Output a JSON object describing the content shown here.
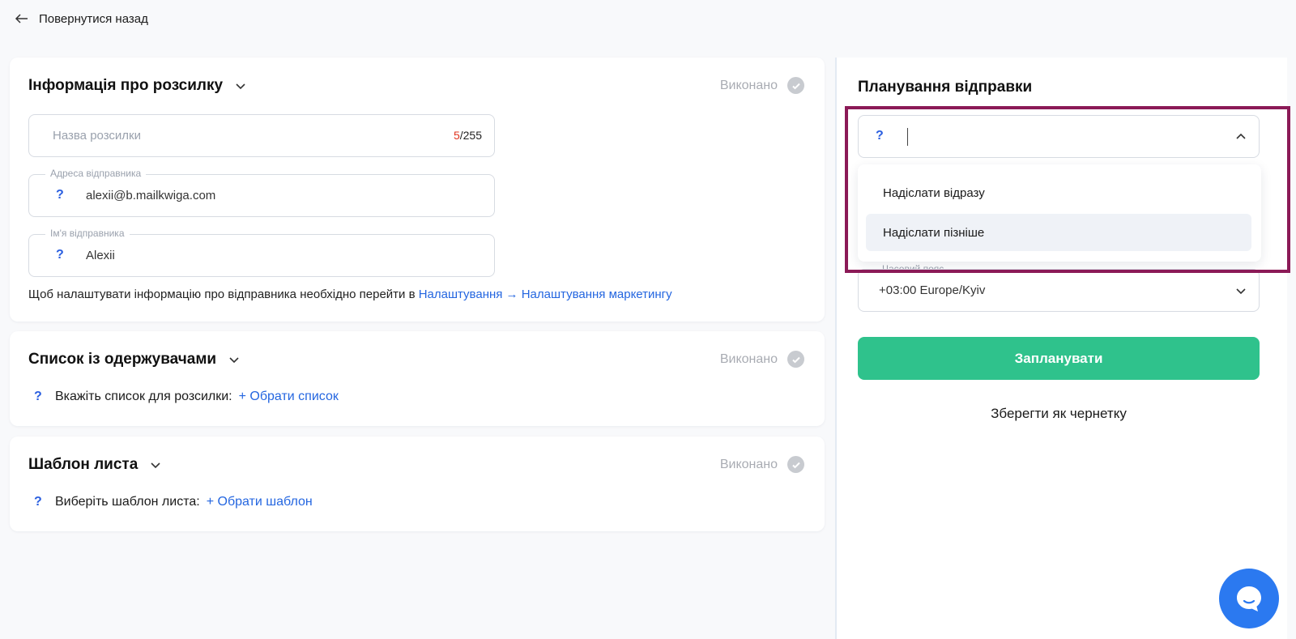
{
  "back_label": "Повернутися назад",
  "sections": {
    "info": {
      "title": "Інформація про розсилку",
      "status": "Виконано",
      "campaign_name_placeholder": "Назва розсилки",
      "counter_current": "5",
      "counter_max": "/255",
      "sender_address_label": "Адреса відправника",
      "sender_address_value": "alexii@b.mailkwiga.com",
      "sender_name_label": "Ім'я відправника",
      "sender_name_value": "Alexii",
      "hint_text": "Щоб налаштувати інформацію про відправника необхідно перейти в ",
      "hint_link": "Налаштування → Налаштування маркетингу"
    },
    "recipients": {
      "title": "Список із одержувачами",
      "status": "Виконано",
      "label": "Вкажіть список для розсилки:",
      "link": "+ Обрати список"
    },
    "template": {
      "title": "Шаблон листа",
      "status": "Виконано",
      "label": "Виберіть шаблон листа:",
      "link": "+ Обрати шаблон"
    }
  },
  "schedule": {
    "title": "Планування відправки",
    "send_mode_value": "",
    "options": [
      "Надіслати відразу",
      "Надіслати пізніше"
    ],
    "highlighted_option": "Надіслати пізніше",
    "timezone_label": "Часовий пояс",
    "timezone_value": "+03:00 Europe/Kyiv",
    "schedule_button": "Запланувати",
    "save_draft_button": "Зберегти як чернетку"
  },
  "help_glyph": "?",
  "colors": {
    "accent_green": "#2fc28c",
    "link_blue": "#2466e0",
    "highlight_frame": "#8b1a57",
    "chat_blue": "#2b79f0"
  }
}
